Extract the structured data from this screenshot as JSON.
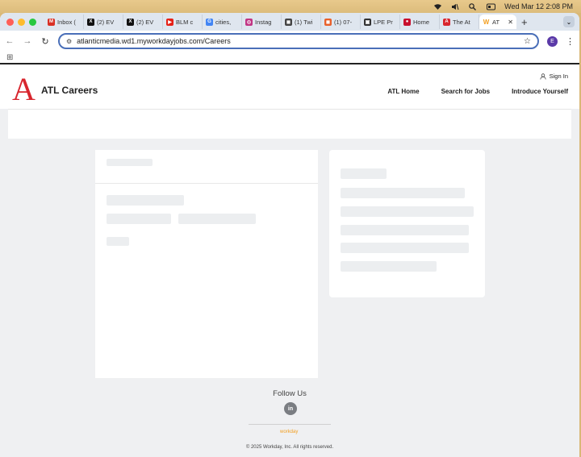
{
  "menubar": {
    "datetime": "Wed Mar 12  2:08 PM"
  },
  "tabs": [
    {
      "label": "Inbox (",
      "icon": "gmail-icon",
      "color": "#d93025",
      "glyph": "M"
    },
    {
      "label": "(2) EV",
      "icon": "x-icon",
      "color": "#111111",
      "glyph": "X"
    },
    {
      "label": "(2) EV",
      "icon": "x-icon",
      "color": "#111111",
      "glyph": "X"
    },
    {
      "label": "BLM c",
      "icon": "youtube-icon",
      "color": "#e62117",
      "glyph": "▶"
    },
    {
      "label": "cities, ",
      "icon": "google-icon",
      "color": "#4285f4",
      "glyph": "G"
    },
    {
      "label": "Instag",
      "icon": "instagram-icon",
      "color": "#c13584",
      "glyph": "◎"
    },
    {
      "label": "(1) Twi",
      "icon": "twitch-icon",
      "color": "#444444",
      "glyph": "◼"
    },
    {
      "label": "(1) 07-",
      "icon": "app-icon",
      "color": "#e8612c",
      "glyph": "◼"
    },
    {
      "label": "LPE Pr",
      "icon": "doc-icon",
      "color": "#333333",
      "glyph": "▣"
    },
    {
      "label": "Home ",
      "icon": "news-icon",
      "color": "#c8102e",
      "glyph": "●"
    },
    {
      "label": "The At",
      "icon": "atlantic-icon",
      "color": "#d8262e",
      "glyph": "A"
    }
  ],
  "active_tab": {
    "label": "AT",
    "icon": "workday-icon",
    "color": "#f29e1f",
    "glyph": "W"
  },
  "address_bar": {
    "url": "atlanticmedia.wd1.myworkdayjobs.com/Careers"
  },
  "profile": {
    "initial": "E"
  },
  "site": {
    "logo_letter": "A",
    "brand_name": "ATL Careers",
    "sign_in": "Sign In",
    "nav": [
      "ATL Home",
      "Search for Jobs",
      "Introduce Yourself"
    ]
  },
  "footer": {
    "follow_us": "Follow Us",
    "social_label": "in",
    "workday_logo": "workday",
    "copyright": "© 2025 Workday, Inc. All rights reserved."
  },
  "colors": {
    "brand_red": "#d8262e",
    "page_bg": "#eff0f2",
    "skeleton": "#eceef0"
  }
}
